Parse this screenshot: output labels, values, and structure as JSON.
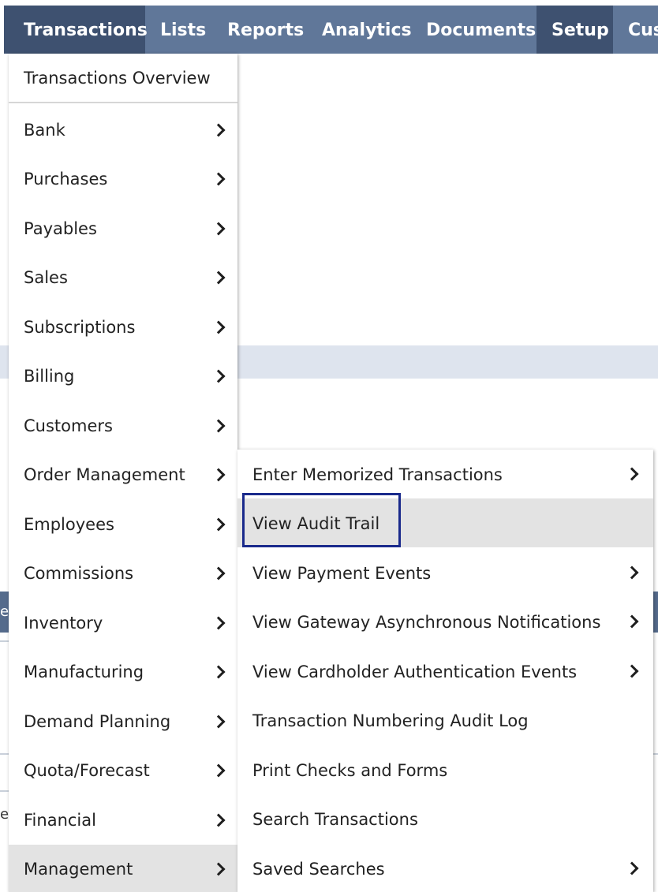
{
  "nav": {
    "items": [
      "Transactions",
      "Lists",
      "Reports",
      "Analytics",
      "Documents",
      "Setup",
      "Cus"
    ]
  },
  "menu": {
    "overview": "Transactions Overview",
    "items": [
      "Bank",
      "Purchases",
      "Payables",
      "Sales",
      "Subscriptions",
      "Billing",
      "Customers",
      "Order Management",
      "Employees",
      "Commissions",
      "Inventory",
      "Manufacturing",
      "Demand Planning",
      "Quota/Forecast",
      "Financial",
      "Management"
    ],
    "active_item": "Management"
  },
  "submenu": {
    "items": [
      {
        "label": "Enter Memorized Transactions",
        "has_children": true
      },
      {
        "label": "View Audit Trail",
        "has_children": false
      },
      {
        "label": "View Payment Events",
        "has_children": true
      },
      {
        "label": "View Gateway Asynchronous Notifications",
        "has_children": true
      },
      {
        "label": "View Cardholder Authentication Events",
        "has_children": true
      },
      {
        "label": "Transaction Numbering Audit Log",
        "has_children": false
      },
      {
        "label": "Print Checks and Forms",
        "has_children": false
      },
      {
        "label": "Search Transactions",
        "has_children": false
      },
      {
        "label": "Saved Searches",
        "has_children": true
      }
    ],
    "highlighted_item": "View Audit Trail"
  },
  "background_fragments": [
    "e",
    "e"
  ],
  "colors": {
    "nav_bg": "#607799",
    "nav_active_bg": "#3e5170",
    "menu_hover": "#e3e3e3",
    "highlight_border": "#1a2a8c"
  }
}
